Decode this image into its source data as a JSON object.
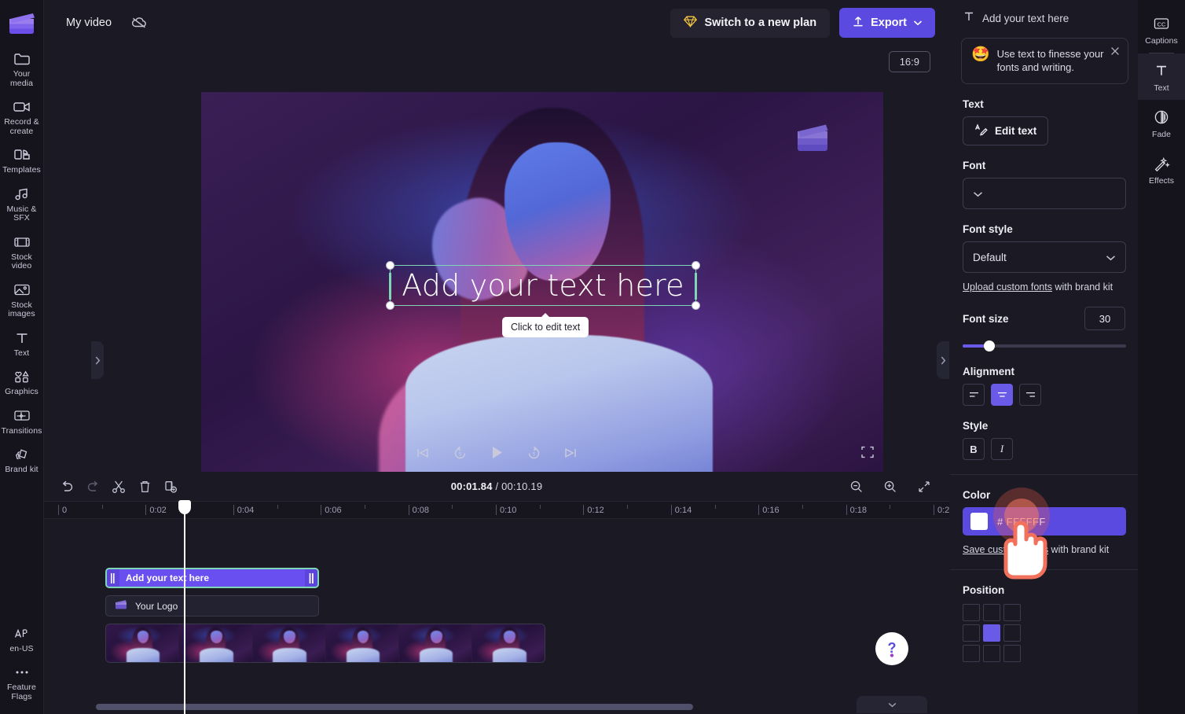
{
  "left_rail": {
    "logo": "clapperboard-logo",
    "items": [
      {
        "label": "Your media",
        "icon": "folder-icon"
      },
      {
        "label": "Record & create",
        "icon": "video-camera-icon"
      },
      {
        "label": "Templates",
        "icon": "templates-icon"
      },
      {
        "label": "Music & SFX",
        "icon": "music-note-icon"
      },
      {
        "label": "Stock video",
        "icon": "film-strip-icon"
      },
      {
        "label": "Stock images",
        "icon": "image-icon"
      },
      {
        "label": "Text",
        "icon": "text-t-icon"
      },
      {
        "label": "Graphics",
        "icon": "graphics-shapes-icon"
      },
      {
        "label": "Transitions",
        "icon": "transitions-icon"
      },
      {
        "label": "Brand kit",
        "icon": "brand-kit-icon"
      }
    ],
    "bottom_items": [
      {
        "label": "en-US",
        "icon": "language-icon"
      },
      {
        "label": "Feature Flags",
        "icon": "ellipsis-icon"
      }
    ]
  },
  "topbar": {
    "project_name": "My video",
    "cloud_icon": "cloud-offline-icon",
    "plan_button": "Switch to a new plan",
    "plan_icon": "diamond-icon",
    "export_button": "Export",
    "export_icon": "upload-arrow-icon",
    "export_chevron": "chevron-down-icon"
  },
  "stage": {
    "ratio_badge": "16:9",
    "overlay_text": "Add your text here",
    "edit_tooltip": "Click to edit text",
    "watermark_icon": "clapperboard-watermark",
    "collapse_left_icon": "chevron-right-icon",
    "collapse_right_icon": "chevron-right-icon",
    "help_label": "?",
    "help_chevron": "chevron-down-icon",
    "selection_color": "#7fd6b6"
  },
  "playback": {
    "skip_back": "skip-to-start-icon",
    "rewind_5": "rewind-5s-icon",
    "play": "play-icon",
    "forward_5": "forward-5s-icon",
    "skip_forward": "skip-to-end-icon",
    "fullscreen": "fullscreen-icon"
  },
  "timeline": {
    "tools": [
      {
        "name": "undo-button",
        "icon": "undo-icon"
      },
      {
        "name": "redo-button",
        "icon": "redo-icon"
      },
      {
        "name": "split-button",
        "icon": "scissors-icon"
      },
      {
        "name": "delete-button",
        "icon": "trash-icon"
      },
      {
        "name": "duplicate-button",
        "icon": "duplicate-icon"
      }
    ],
    "current_time": "00:01.84",
    "time_separator": "/",
    "total_time": "00:10.19",
    "zoom_out_icon": "zoom-out-icon",
    "zoom_in_icon": "zoom-in-icon",
    "fit_icon": "fit-to-timeline-icon",
    "ruler_labels": [
      "0",
      "0:02",
      "0:04",
      "0:06",
      "0:08",
      "0:10",
      "0:12",
      "0:14",
      "0:16",
      "0:18",
      "0:2"
    ],
    "clips": {
      "text_clip": "Add your text here",
      "logo_clip": "Your Logo",
      "video_clip": "video-thumbnails"
    },
    "playhead_position": "00:01.84"
  },
  "right_panel": {
    "header_title": "Add your text here",
    "header_icon": "text-t-icon",
    "tip": {
      "emoji": "🤩",
      "text": "Use text to finesse your fonts and writing.",
      "close_icon": "close-icon"
    },
    "text_section": {
      "label": "Text",
      "edit_button": "Edit text",
      "edit_icon": "edit-text-icon"
    },
    "font_section": {
      "label": "Font",
      "value": "",
      "chevron": "chevron-down-icon"
    },
    "font_style_section": {
      "label": "Font style",
      "value": "Default",
      "chevron": "chevron-down-icon",
      "upload_link": "Upload custom fonts",
      "upload_suffix": " with brand kit"
    },
    "font_size_section": {
      "label": "Font size",
      "value": "30",
      "slider_percent": 15
    },
    "alignment_section": {
      "label": "Alignment",
      "options": [
        {
          "name": "align-left",
          "icon": "align-left-icon",
          "active": false
        },
        {
          "name": "align-center",
          "icon": "align-center-icon",
          "active": true
        },
        {
          "name": "align-right",
          "icon": "align-right-icon",
          "active": false
        }
      ]
    },
    "style_section": {
      "label": "Style",
      "bold": "B",
      "italic": "I"
    },
    "color_section": {
      "label": "Color",
      "hex": "# FFFFFF",
      "swatch": "#FFFFFF",
      "save_link": "Save custom colors",
      "save_suffix": " with brand kit"
    },
    "position_section": {
      "label": "Position",
      "active_index": 4
    }
  },
  "far_rail": {
    "items": [
      {
        "label": "Captions",
        "icon": "closed-captions-icon",
        "active": false
      },
      {
        "label": "Text",
        "icon": "text-t-icon",
        "active": true
      },
      {
        "label": "Fade",
        "icon": "fade-circle-icon",
        "active": false
      },
      {
        "label": "Effects",
        "icon": "magic-wand-icon",
        "active": false
      }
    ]
  },
  "colors": {
    "accent": "#5b4ae0",
    "accent_light": "#6a5ae8",
    "selection": "#7fd6b6",
    "bg": "#1b1a24",
    "rail_bg": "#15141c",
    "cursor_ring": "#eb5a46"
  }
}
